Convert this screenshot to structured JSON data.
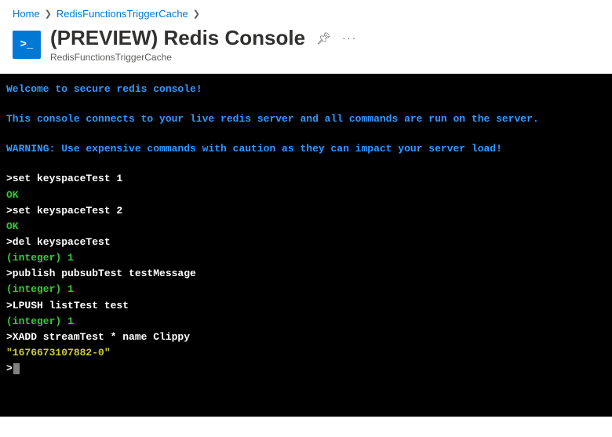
{
  "breadcrumb": {
    "items": [
      "Home",
      "RedisFunctionsTriggerCache"
    ]
  },
  "page": {
    "title": "(PREVIEW) Redis Console",
    "subtitle": "RedisFunctionsTriggerCache",
    "icon_glyph": ">_"
  },
  "console": {
    "welcome": "Welcome to secure redis console!",
    "info": "This console connects to your live redis server and all commands are run on the server.",
    "warning": "WARNING: Use expensive commands with caution as they can impact your server load!",
    "lines": [
      {
        "type": "cmd",
        "text": ">set keyspaceTest 1"
      },
      {
        "type": "ok",
        "text": "OK"
      },
      {
        "type": "cmd",
        "text": ">set keyspaceTest 2"
      },
      {
        "type": "ok",
        "text": "OK"
      },
      {
        "type": "cmd",
        "text": ">del keyspaceTest"
      },
      {
        "type": "int",
        "text": "(integer) 1"
      },
      {
        "type": "cmd",
        "text": ">publish pubsubTest testMessage"
      },
      {
        "type": "int",
        "text": "(integer) 1"
      },
      {
        "type": "cmd",
        "text": ">LPUSH listTest test"
      },
      {
        "type": "int",
        "text": "(integer) 1"
      },
      {
        "type": "cmd",
        "text": ">XADD streamTest * name Clippy"
      },
      {
        "type": "str",
        "text": "\"1676673107882-0\""
      }
    ],
    "prompt": ">"
  }
}
